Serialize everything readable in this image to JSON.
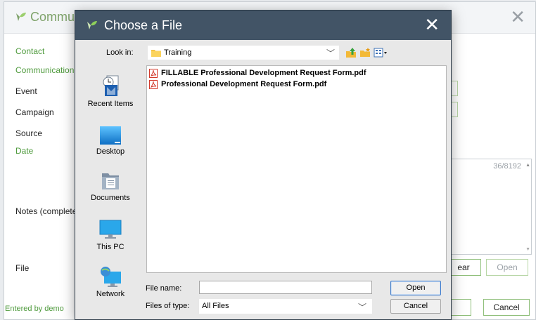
{
  "background_dialog": {
    "title": "Commu",
    "labels": {
      "contact": "Contact",
      "communication": "Communication",
      "event": "Event",
      "campaign": "Campaign",
      "source": "Source",
      "date": "Date",
      "notes": "Notes (complete",
      "file": "File",
      "entered_by": "Entered by demo"
    },
    "notes_counter": "36/8192",
    "buttons": {
      "clear": "ear",
      "open": "Open",
      "cancel": "Cancel"
    }
  },
  "chooser": {
    "title": "Choose a File",
    "look_in_label": "Look in:",
    "look_in_value": "Training",
    "places": [
      {
        "label": "Recent Items"
      },
      {
        "label": "Desktop"
      },
      {
        "label": "Documents"
      },
      {
        "label": "This PC"
      },
      {
        "label": "Network"
      }
    ],
    "files": [
      {
        "name": "FILLABLE Professional Development Request Form.pdf",
        "icon": "pdf-icon"
      },
      {
        "name": "Professional Development Request Form.pdf",
        "icon": "pdf-icon"
      }
    ],
    "file_name_label": "File name:",
    "file_name_value": "",
    "files_of_type_label": "Files of type:",
    "files_of_type_value": "All Files",
    "open_button": "Open",
    "cancel_button": "Cancel"
  },
  "colors": {
    "chooser_titlebar": "#425466",
    "accent_green": "#4e9a3c",
    "pdf_red": "#d33a2c"
  },
  "icons": [
    "leaf-logo-icon",
    "close-icon",
    "folder-icon",
    "chevron-down-icon",
    "up-folder-icon",
    "new-folder-icon",
    "view-menu-icon",
    "recent-items-icon",
    "desktop-icon",
    "documents-icon",
    "this-pc-icon",
    "network-icon",
    "pdf-icon"
  ]
}
